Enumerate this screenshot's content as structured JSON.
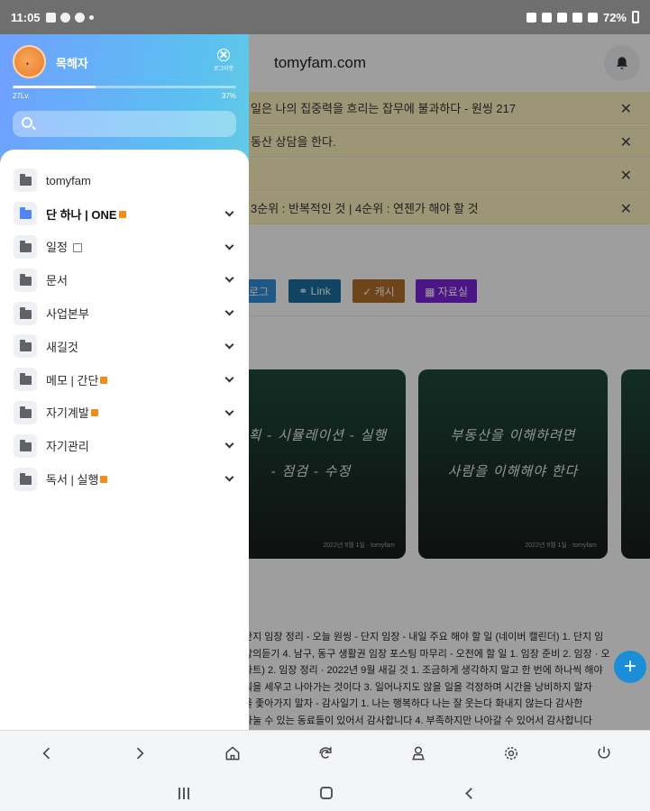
{
  "status_bar": {
    "time": "11:05",
    "battery": "72%"
  },
  "page": {
    "site_title": "tomyfam.com",
    "notices": [
      "일은 나의 집중력을 흐리는 잡무에 불과하다 - 원씽 217",
      "동산 상담을 한다.",
      "",
      "3순위 : 반복적인 것 | 4순위 : 연젠가 해야 할 것"
    ],
    "tag_buttons": [
      {
        "label": "로그",
        "color": "#2f8fd8"
      },
      {
        "label": "⚭ Link",
        "color": "#1c6fa0"
      },
      {
        "label": "✓ 캐시",
        "color": "#b26f2a"
      },
      {
        "label": "▦ 자료실",
        "color": "#7a22d8"
      }
    ],
    "cards": [
      {
        "line1": "계획 - 시뮬레이션 - 실행",
        "line2": "- 점검 - 수정",
        "footer": "2022년 9월 1일 · tomyfam"
      },
      {
        "line1": "부동산을 이해하려면",
        "line2": "사람을 이해해야 한다",
        "footer": "2022년 9월 1일 · tomyfam"
      }
    ],
    "body_lines": [
      "단지 임장 정리 - 오늘 원씽 - 단지 임장 - 내일 주요 해야 할 일 (네이버 캘린더) 1. 단지 임",
      "강의듣기 4. 남구, 동구 생활권 임장 포스팅 마무리 - 오전에 할 일 1. 임장 준비 2. 임장 · 오",
      "파트) 2. 임장 정리 · 2022년 9월 새길 것 1. 조금하게 생각하지 말고 한 번에 하나씩 해야",
      "워을 세우고 나아가는 것이다 3. 일어나지도 않을 일을 걱정하며 시간을 낭비하지 말자",
      "을 좇아가지 말자 - 감사일기 1. 나는 행복하다 나는 잘 웃는다 화내지 않는다 감사한",
      "나눌 수 있는 동료들이 있어서 감사합니다 4. 부족하지만 나아갈 수 있어서 감사합니다"
    ],
    "fab_label": "+"
  },
  "drawer": {
    "username": "목해자",
    "logout_label": "로그아웃",
    "level": "27Lv.",
    "percent": "37%",
    "progress_fraction": 0.37,
    "menu": [
      {
        "label": "tomyfam",
        "icon": "folder-icon",
        "badge": false,
        "chevron": false,
        "strong": false
      },
      {
        "label": "단 하나 | ONE",
        "icon": "folder-icon",
        "badge": true,
        "chevron": true,
        "strong": true
      },
      {
        "label": "일정",
        "icon": "folder-icon",
        "badge": false,
        "chevron": true,
        "strong": false,
        "external": true
      },
      {
        "label": "문서",
        "icon": "folder-icon",
        "badge": false,
        "chevron": true,
        "strong": false
      },
      {
        "label": "사업본부",
        "icon": "folder-icon",
        "badge": false,
        "chevron": true,
        "strong": false
      },
      {
        "label": "새길것",
        "icon": "folder-icon",
        "badge": false,
        "chevron": true,
        "strong": false
      },
      {
        "label": "메모 | 간단",
        "icon": "folder-icon",
        "badge": true,
        "chevron": true,
        "strong": false
      },
      {
        "label": "자기계발",
        "icon": "folder-icon",
        "badge": true,
        "chevron": true,
        "strong": false
      },
      {
        "label": "자기관리",
        "icon": "folder-icon",
        "badge": false,
        "chevron": true,
        "strong": false
      },
      {
        "label": "독서 | 실행",
        "icon": "folder-icon",
        "badge": true,
        "chevron": true,
        "strong": false
      }
    ]
  },
  "bottom_bar": [
    "back-icon",
    "forward-icon",
    "home-icon",
    "refresh-icon",
    "user-icon",
    "settings-icon",
    "power-icon"
  ],
  "system_nav": [
    "recents-icon",
    "home-icon",
    "back-icon"
  ]
}
